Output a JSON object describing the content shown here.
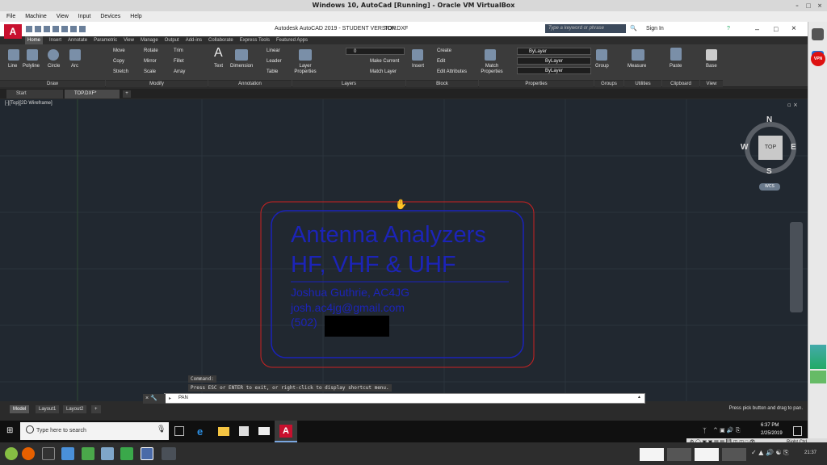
{
  "vbox": {
    "title": "Windows 10, AutoCad [Running] - Oracle VM VirtualBox",
    "menu": [
      "File",
      "Machine",
      "View",
      "Input",
      "Devices",
      "Help"
    ]
  },
  "acad": {
    "title": "Autodesk AutoCAD 2019 - STUDENT VERSION",
    "file": "TOP.DXF",
    "search_placeholder": "Type a keyword or phrase",
    "sign_in": "Sign In",
    "logo": "A"
  },
  "ribbon_tabs": [
    "Home",
    "Insert",
    "Annotate",
    "Parametric",
    "View",
    "Manage",
    "Output",
    "Add-ins",
    "Collaborate",
    "Express Tools",
    "Featured Apps"
  ],
  "ribbon": {
    "draw": {
      "line": "Line",
      "polyline": "Polyline",
      "circle": "Circle",
      "arc": "Arc"
    },
    "modify": {
      "move": "Move",
      "rotate": "Rotate",
      "trim": "Trim",
      "copy": "Copy",
      "mirror": "Mirror",
      "fillet": "Fillet",
      "stretch": "Stretch",
      "scale": "Scale",
      "array": "Array"
    },
    "annotation": {
      "text": "Text",
      "dimension": "Dimension",
      "linear": "Linear",
      "leader": "Leader",
      "table": "Table"
    },
    "layers": {
      "layer_properties": "Layer Properties",
      "current_layer": "0",
      "make_current": "Make Current",
      "match_layer": "Match Layer"
    },
    "block": {
      "insert": "Insert",
      "create": "Create",
      "edit": "Edit",
      "edit_attributes": "Edit Attributes"
    },
    "properties": {
      "match": "Match Properties",
      "bylayer1": "ByLayer",
      "bylayer2": "ByLayer",
      "bylayer3": "ByLayer"
    },
    "groups": {
      "group": "Group"
    },
    "utilities": {
      "measure": "Measure"
    },
    "clipboard": {
      "paste": "Paste"
    },
    "view": {
      "base": "Base"
    },
    "groups_labels": [
      "Draw",
      "Modify",
      "Annotation",
      "Layers",
      "Block",
      "Properties",
      "Groups",
      "Utilities",
      "Clipboard",
      "View"
    ]
  },
  "doc_tabs": [
    "Start",
    "TOP.DXF*"
  ],
  "viewport": {
    "label": "[-][Top][2D Wireframe]",
    "viewcube": {
      "n": "N",
      "s": "S",
      "e": "E",
      "w": "W",
      "top": "TOP",
      "wcs": "WCS"
    },
    "drawing": {
      "line1": "Antenna Analyzers",
      "line2": "HF, VHF & UHF",
      "line3": "Joshua Guthrie, AC4JG",
      "line4": "josh.ac4jg@gmail.com",
      "line5": "(502)"
    }
  },
  "command": {
    "history1": "Command:",
    "history2": "Press ESC or ENTER to exit, or right-click to display shortcut menu.",
    "prompt": "PAN"
  },
  "layouts": [
    "Model",
    "Layout1",
    "Layout2"
  ],
  "status_msg": "Press pick button and drag to pan.",
  "taskbar": {
    "search": "Type here to search",
    "time": "6:37 PM",
    "date": "2/25/2019"
  },
  "linux": {
    "right_ctrl": "Right Ctrl",
    "clock": "21:37"
  },
  "side": {
    "vpn": "VPN"
  }
}
